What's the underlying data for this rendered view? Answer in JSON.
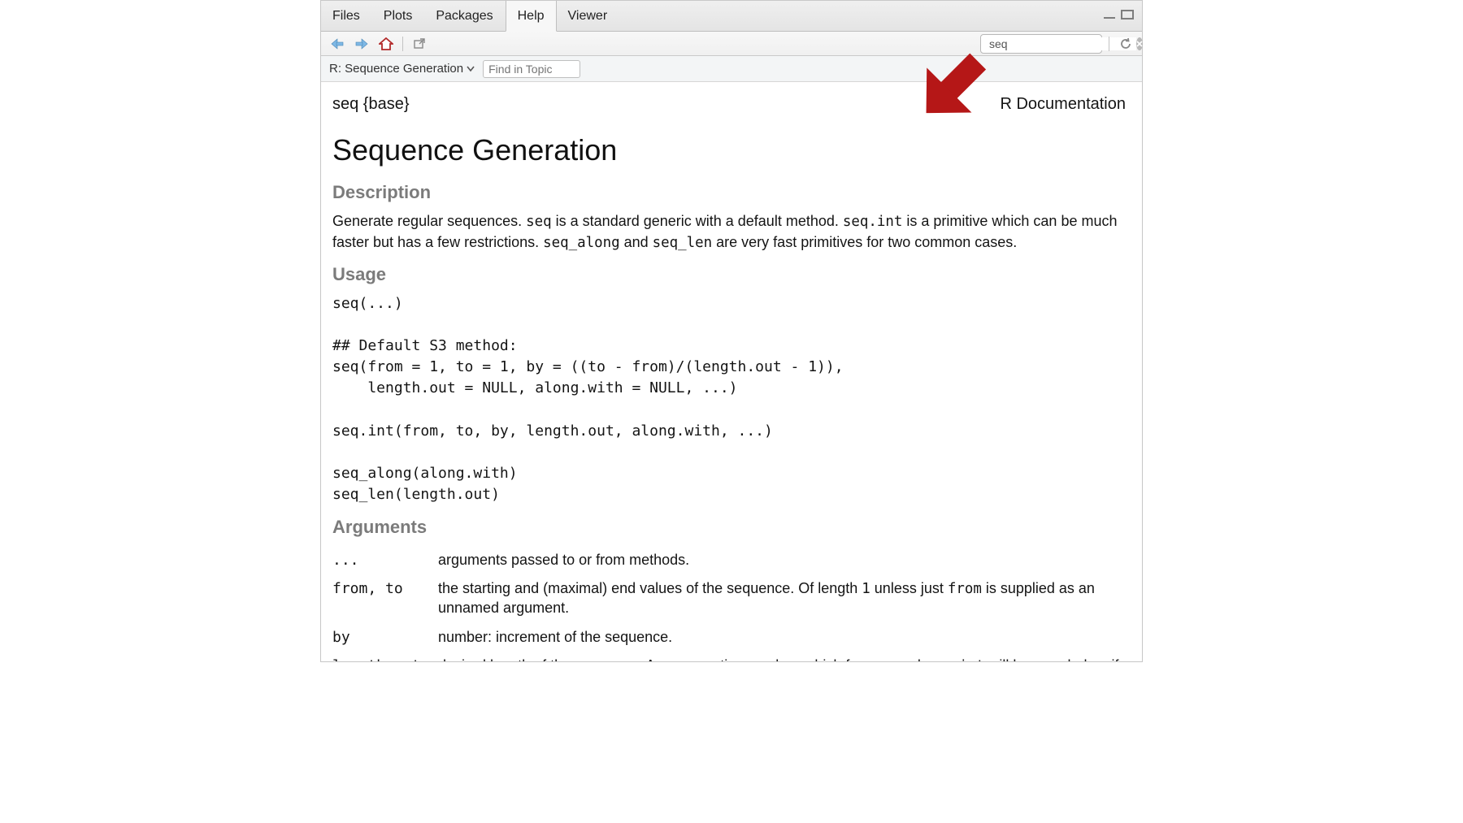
{
  "tabs": {
    "files": "Files",
    "plots": "Plots",
    "packages": "Packages",
    "help": "Help",
    "viewer": "Viewer"
  },
  "toolbar": {
    "search_value": "seq"
  },
  "crumb": {
    "label": "R: Sequence Generation",
    "find_placeholder": "Find in Topic"
  },
  "doc": {
    "pkg_header": "seq {base}",
    "rdoc_label": "R Documentation",
    "title": "Sequence Generation",
    "sec_description": "Description",
    "desc_1": "Generate regular sequences. ",
    "desc_code1": "seq",
    "desc_2": " is a standard generic with a default method. ",
    "desc_code2": "seq.int",
    "desc_3": " is a primitive which can be much faster but has a few restrictions. ",
    "desc_code3": "seq_along",
    "desc_4": " and ",
    "desc_code4": "seq_len",
    "desc_5": " are very fast primitives for two common cases.",
    "sec_usage": "Usage",
    "usage_block": "seq(...)\n\n## Default S3 method:\nseq(from = 1, to = 1, by = ((to - from)/(length.out - 1)),\n    length.out = NULL, along.with = NULL, ...)\n\nseq.int(from, to, by, length.out, along.with, ...)\n\nseq_along(along.with)\nseq_len(length.out)",
    "sec_arguments": "Arguments",
    "args": {
      "a0_name": "...",
      "a0_desc": "arguments passed to or from methods.",
      "a1_name": "from, to",
      "a1_desc_1": "the starting and (maximal) end values of the sequence. Of length ",
      "a1_code1": "1",
      "a1_desc_2": " unless just ",
      "a1_code2": "from",
      "a1_desc_3": " is supplied as an unnamed argument.",
      "a2_name": "by",
      "a2_desc": "number: increment of the sequence.",
      "a3_name": "length.out",
      "a3_desc_1": "desired length of the sequence. A non-negative number, which for ",
      "a3_code1": "seq",
      "a3_desc_2": " and ",
      "a3_code2": "seq.int",
      "a3_desc_3": " will be rounded up if fractional"
    }
  }
}
